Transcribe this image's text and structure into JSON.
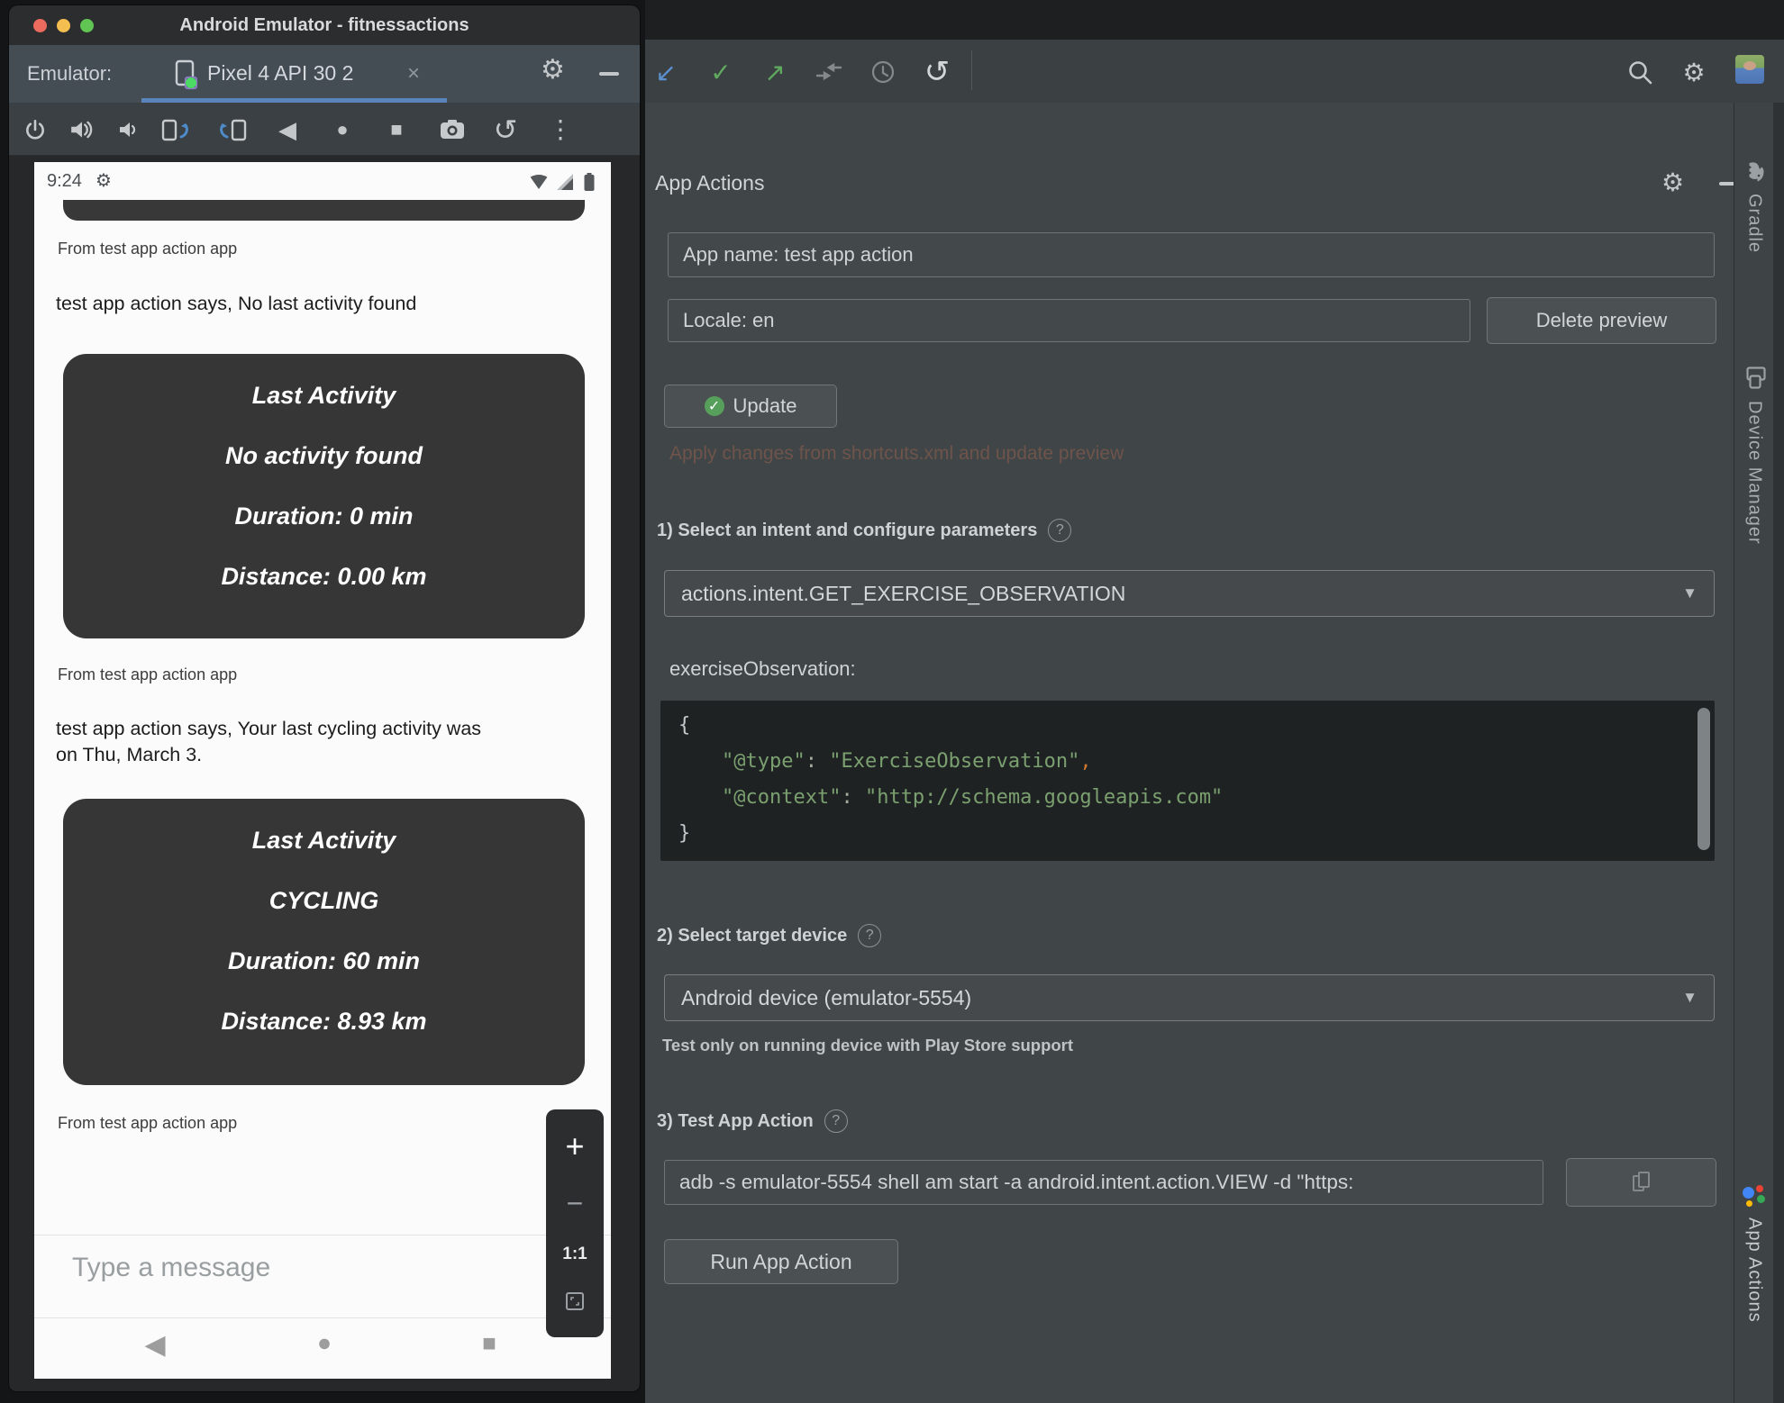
{
  "window": {
    "title": "Android Emulator - fitnessactions",
    "tab_label": "Emulator:",
    "tab_name": "Pixel 4 API 30 2"
  },
  "phone": {
    "time": "9:24",
    "from_label": "From test app action app",
    "message1": "test app action says, No last activity found",
    "message2": "test app action says, Your last cycling activity was on Thu, March 3.",
    "card1": {
      "title": "Last Activity",
      "line1": "No activity found",
      "line2": "Duration: 0 min",
      "line3": "Distance: 0.00 km"
    },
    "card2": {
      "title": "Last Activity",
      "line1": "CYCLING",
      "line2": "Duration: 60 min",
      "line3": "Distance: 8.93 km"
    },
    "input_placeholder": "Type a message",
    "zoom": {
      "in": "+",
      "out": "−",
      "ratio": "1:1"
    }
  },
  "studio": {
    "panel_title": "App Actions",
    "app_name_value": "App name: test app action",
    "locale_value": "Locale: en",
    "delete_preview": "Delete preview",
    "update": "Update",
    "hint": "Apply changes from shortcuts.xml and update preview",
    "section1_label": "1) Select an intent and configure parameters",
    "intent_value": "actions.intent.GET_EXERCISE_OBSERVATION",
    "observation_label": "exerciseObservation:",
    "code": {
      "open": "{",
      "type_key": "\"@type\"",
      "sep": ": ",
      "type_val": "\"ExerciseObservation\"",
      "comma": ",",
      "ctx_key": "\"@context\"",
      "ctx_val": "\"http://schema.googleapis.com\"",
      "close": "}"
    },
    "section2_label": "2) Select target device",
    "device_value": "Android device (emulator-5554)",
    "device_caption": "Test only on running device with Play Store support",
    "section3_label": "3) Test App Action",
    "adb_command": "adb -s emulator-5554 shell am start -a android.intent.action.VIEW -d \"https:",
    "run_button": "Run App Action",
    "help": "?"
  },
  "strip": {
    "gradle": "Gradle",
    "device_manager": "Device Manager",
    "app_actions": "App Actions"
  },
  "icons": {
    "gear": "⚙",
    "caret": "▼",
    "kebab": "⋮",
    "back": "◀",
    "home": "●",
    "overview": "■",
    "undo": "↺",
    "arrow_sw": "↙",
    "check": "✓",
    "arrow_ne": "↗",
    "close": "×",
    "checkmark": "✓"
  },
  "colors": {
    "tab_accent": "#5b84bd",
    "update_check_green": "#57a05c",
    "code_green": "#7ba06f",
    "code_orange": "#cc7832"
  }
}
